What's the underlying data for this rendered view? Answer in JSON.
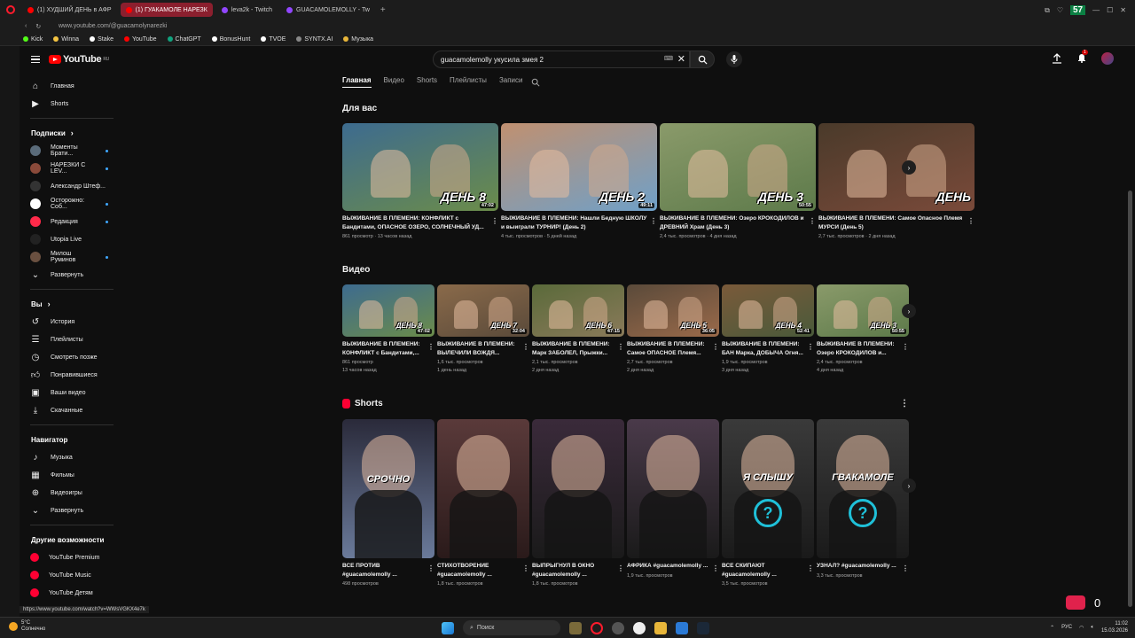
{
  "browser": {
    "tabs": [
      {
        "label": "(1) ХУДШИЙ ДЕНЬ в АФР",
        "icon": "youtube-icon",
        "active": false
      },
      {
        "label": "(1) ГУАКАМОЛЕ НАРЕЗК",
        "icon": "youtube-icon",
        "active": true
      },
      {
        "label": "leva2k - Twitch",
        "icon": "twitch-icon",
        "active": false
      },
      {
        "label": "GUACAMOLEMOLLY - Tw",
        "icon": "twitch-icon",
        "active": false
      }
    ],
    "url": "www.youtube.com/@guacamolynarezki",
    "counter": "57",
    "bookmarks": [
      "Kick",
      "Winna",
      "Stake",
      "YouTube",
      "ChatGPT",
      "BonusHunt",
      "TVOE",
      "SYNTX.AI",
      "Музыка"
    ]
  },
  "header": {
    "logo": "YouTube",
    "logo_sup": "RU",
    "search_value": "guacamolemolly укусила змея 2",
    "kb_icon": "keyboard-icon",
    "notif_count": "1"
  },
  "sidebar": {
    "top": [
      {
        "label": "Главная",
        "icon": "home-icon"
      },
      {
        "label": "Shorts",
        "icon": "shorts-icon"
      }
    ],
    "subs_title": "Подписки",
    "subs": [
      {
        "label": "Моменты Брати...",
        "color": "#5a6b7a",
        "live": true
      },
      {
        "label": "НАРЕЗКИ С LEV...",
        "color": "#8a4a3a",
        "live": true
      },
      {
        "label": "Александр Штеф...",
        "color": "#333333",
        "live": false
      },
      {
        "label": "Осторожно: Соб...",
        "color": "#ffffff",
        "live": true
      },
      {
        "label": "Редакция",
        "color": "#ff2a4a",
        "live": true
      },
      {
        "label": "Utopia Live",
        "color": "#222222",
        "live": false
      },
      {
        "label": "Милош Руминов",
        "color": "#6a5040",
        "live": true
      },
      {
        "label": "Развернуть",
        "color": "",
        "live": false
      }
    ],
    "you_title": "Вы",
    "you": [
      {
        "label": "История",
        "icon": "history-icon"
      },
      {
        "label": "Плейлисты",
        "icon": "playlist-icon"
      },
      {
        "label": "Смотреть позже",
        "icon": "clock-icon"
      },
      {
        "label": "Понравившиеся",
        "icon": "thumb-up-icon"
      },
      {
        "label": "Ваши видео",
        "icon": "video-icon"
      },
      {
        "label": "Скачанные",
        "icon": "download-icon"
      }
    ],
    "nav_title": "Навигатор",
    "nav": [
      {
        "label": "Музыка",
        "icon": "music-icon"
      },
      {
        "label": "Фильмы",
        "icon": "film-icon"
      },
      {
        "label": "Видеоигры",
        "icon": "gamepad-icon"
      },
      {
        "label": "Развернуть",
        "icon": "chevron-down-icon"
      }
    ],
    "more_title": "Другие возможности",
    "more": [
      {
        "label": "YouTube Premium"
      },
      {
        "label": "YouTube Music"
      },
      {
        "label": "YouTube Детям"
      }
    ]
  },
  "channel_tabs": [
    "Главная",
    "Видео",
    "Shorts",
    "Плейлисты",
    "Записи"
  ],
  "for_you": {
    "title": "Для вас",
    "items": [
      {
        "title": "ВЫЖИВАНИЕ В ПЛЕМЕНИ: КОНФЛИКТ с Бандитами, ОПАСНОЕ ОЗЕРО, СОЛНЕЧНЫЙ УД...",
        "views": "861 просмотр",
        "ago": "13 часов назад",
        "duration": "47:02",
        "day": "ДЕНЬ 8",
        "c1": "#6b8c4a",
        "c2": "#3d6b8f"
      },
      {
        "title": "ВЫЖИВАНИЕ В ПЛЕМЕНИ: Нашли Бедную ШКОЛУ и выиграли ТУРНИР! (День 2)",
        "views": "4 тыс. просмотров",
        "ago": "5 дней назад",
        "duration": "49:11",
        "day": "ДЕНЬ 2",
        "c1": "#6fa0c8",
        "c2": "#c09070"
      },
      {
        "title": "ВЫЖИВАНИЕ В ПЛЕМЕНИ: Озеро КРОКОДИЛОВ и ДРЕВНИЙ Храм (День 3)",
        "views": "2,4 тыс. просмотров",
        "ago": "4 дня назад",
        "duration": "50:55",
        "day": "ДЕНЬ 3",
        "c1": "#5d7a4a",
        "c2": "#8a9a6a"
      },
      {
        "title": "ВЫЖИВАНИЕ В ПЛЕМЕНИ: Самое Опасное Племя МУРСИ (День 5)",
        "views": "2,7 тыс. просмотров",
        "ago": "2 дня назад",
        "duration": "",
        "day": "ДЕНЬ",
        "c1": "#7a4a3a",
        "c2": "#4a3a2a"
      }
    ]
  },
  "videos": {
    "title": "Видео",
    "items": [
      {
        "title": "ВЫЖИВАНИЕ В ПЛЕМЕНИ: КОНФЛИКТ с Бандитами,...",
        "views": "861 просмотр",
        "ago": "13 часов назад",
        "duration": "47:02",
        "day": "ДЕНЬ 8",
        "c1": "#6b8c4a",
        "c2": "#3d6b8f"
      },
      {
        "title": "ВЫЖИВАНИЕ В ПЛЕМЕНИ: ВЫЛЕЧИЛИ ВОЖДЯ...",
        "views": "1,6 тыс. просмотров",
        "ago": "1 день назад",
        "duration": "32:04",
        "day": "ДЕНЬ 7",
        "c1": "#5a4a3a",
        "c2": "#8a6a4a"
      },
      {
        "title": "ВЫЖИВАНИЕ В ПЛЕМЕНИ: Марк ЗАБОЛЕЛ, Прыжки...",
        "views": "2,1 тыс. просмотров",
        "ago": "2 дня назад",
        "duration": "47:15",
        "day": "ДЕНЬ 6",
        "c1": "#8a7a5a",
        "c2": "#5a6a3a"
      },
      {
        "title": "ВЫЖИВАНИЕ В ПЛЕМЕНИ: Самое ОПАСНОЕ Племя...",
        "views": "2,7 тыс. просмотров",
        "ago": "2 дня назад",
        "duration": "36:05",
        "day": "ДЕНЬ 5",
        "c1": "#9a6a4a",
        "c2": "#5a4a3a"
      },
      {
        "title": "ВЫЖИВАНИЕ В ПЛЕМЕНИ: БАН Марка, ДОБЫЧА Огня...",
        "views": "1,9 тыс. просмотров",
        "ago": "3 дня назад",
        "duration": "52:41",
        "day": "ДЕНЬ 4",
        "c1": "#4a5a3a",
        "c2": "#7a5a3a"
      },
      {
        "title": "ВЫЖИВАНИЕ В ПЛЕМЕНИ: Озеро КРОКОДИЛОВ и...",
        "views": "2,4 тыс. просмотров",
        "ago": "4 дня назад",
        "duration": "50:55",
        "day": "ДЕНЬ 3",
        "c1": "#5d7a4a",
        "c2": "#8a9a6a"
      }
    ]
  },
  "shorts": {
    "title": "Shorts",
    "items": [
      {
        "title": "ВСЕ ПРОТИВ #guacamolemolly ...",
        "views": "498 просмотров",
        "caption": "СРОЧНО",
        "c1": "#2a2a3a",
        "c2": "#6a7a9a",
        "q": false
      },
      {
        "title": "СТИХОТВОРЕНИЕ #guacamolemolly ...",
        "views": "1,8 тыс. просмотров",
        "caption": "",
        "c1": "#5a3a3a",
        "c2": "#2a1a1a",
        "q": false
      },
      {
        "title": "ВЫПРЫГНУЛ В ОКНО #guacamolemolly ...",
        "views": "1,8 тыс. просмотров",
        "caption": "",
        "c1": "#3a2a3a",
        "c2": "#1a1a1a",
        "q": false
      },
      {
        "title": "АФРИКА #guacamolemolly ...",
        "views": "1,9 тыс. просмотров",
        "caption": "",
        "c1": "#4a3a4a",
        "c2": "#1a1a1a",
        "q": false
      },
      {
        "title": "ВСЕ СКИПАЮТ #guacamolemolly ...",
        "views": "3,5 тыс. просмотров",
        "caption": "Я СЛЫШУ",
        "c1": "#3a3a3a",
        "c2": "#1a1a1a",
        "q": true
      },
      {
        "title": "УЗНАЛ? #guacamolemolly ...",
        "views": "3,3 тыс. просмотров",
        "caption": "ГВАКАМОЛЕ",
        "c1": "#3a3a3a",
        "c2": "#1a1a1a",
        "q": true
      }
    ]
  },
  "status_url": "https://www.youtube.com/watch?v=WWsVGKX4e7k",
  "hearts_count": "0",
  "taskbar": {
    "weather_temp": "5°C",
    "weather_text": "Солнечно",
    "search": "Поиск",
    "lang": "РУС",
    "time": "11:02",
    "date": "15.03.2026"
  }
}
